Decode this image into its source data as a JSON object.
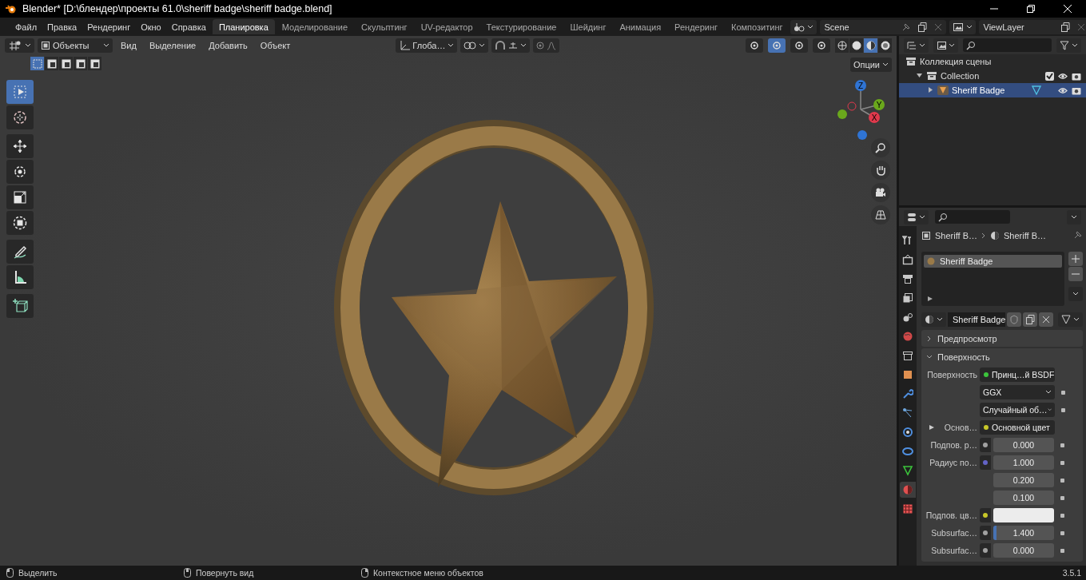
{
  "window": {
    "title": "Blender* [D:\\блендер\\проекты 61.0\\sheriff badge\\sheriff badge.blend]"
  },
  "menu": [
    "Файл",
    "Правка",
    "Рендеринг",
    "Окно",
    "Справка"
  ],
  "workspaces": [
    {
      "label": "Планировка",
      "selected": true
    },
    {
      "label": "Моделирование",
      "selected": false
    },
    {
      "label": "Скульптинг",
      "selected": false
    },
    {
      "label": "UV-редактор",
      "selected": false
    },
    {
      "label": "Текстурирование",
      "selected": false
    },
    {
      "label": "Шейдинг",
      "selected": false
    },
    {
      "label": "Анимация",
      "selected": false
    },
    {
      "label": "Рендеринг",
      "selected": false
    },
    {
      "label": "Композитинг",
      "selected": false
    }
  ],
  "scene": "Scene",
  "view_layer": "ViewLayer",
  "viewport": {
    "mode": "Объекты",
    "menus": [
      "Вид",
      "Выделение",
      "Добавить",
      "Объект"
    ],
    "orientation": "Глоба…",
    "options": "Опции",
    "snap": {
      "on": false
    },
    "select_modes": [
      {
        "selected": true
      },
      {
        "selected": false
      },
      {
        "selected": false
      },
      {
        "selected": false
      },
      {
        "selected": false
      }
    ],
    "toggles": [
      {
        "on": false
      },
      {
        "on": true
      },
      {
        "on": false
      },
      {
        "on": false
      }
    ],
    "shading": [
      {
        "selected": false
      },
      {
        "selected": false
      },
      {
        "selected": true
      },
      {
        "selected": false
      }
    ],
    "tool_groups": [
      [
        {
          "selected": true
        },
        {
          "selected": false
        }
      ],
      [
        {
          "selected": false
        },
        {
          "selected": false
        },
        {
          "selected": false
        },
        {
          "selected": false
        }
      ],
      [
        {
          "selected": false
        },
        {
          "selected": false
        }
      ],
      [
        {
          "selected": false
        }
      ]
    ],
    "gizmo_axes": [
      "Z",
      "Y",
      "X"
    ]
  },
  "outliner": {
    "items": [
      {
        "label": "Коллекция сцены",
        "children": [
          {
            "label": "Collection",
            "expanded": true,
            "checked": true,
            "children": [
              {
                "label": "Sheriff Badge",
                "expanded": false,
                "selected": true
              }
            ]
          }
        ]
      }
    ]
  },
  "properties": {
    "tabs": [
      {
        "selected": false
      },
      {
        "selected": false
      },
      {
        "selected": false
      },
      {
        "selected": false
      },
      {
        "selected": false
      },
      {
        "selected": false
      },
      {
        "selected": false
      },
      {
        "selected": false
      },
      {
        "selected": false
      },
      {
        "selected": false
      },
      {
        "selected": false
      },
      {
        "selected": false
      },
      {
        "selected": false
      },
      {
        "selected": true
      },
      {
        "selected": false
      }
    ],
    "breadcrumb": [
      "Sheriff B…",
      "Sheriff B…"
    ],
    "material_slots": [
      {
        "label": "Sheriff Badge",
        "selected": true
      }
    ],
    "material_name": "Sheriff Badge",
    "panels": [
      {
        "label": "Предпросмотр",
        "expanded": false
      },
      {
        "label": "Поверхность",
        "expanded": true
      }
    ],
    "rows": [
      {
        "kind": "link",
        "color": "#3cc43c",
        "label": "Поверхность",
        "value": "Принц…й BSDF"
      },
      {
        "kind": "dropdown",
        "value": "GGX"
      },
      {
        "kind": "dropdown",
        "value": "Случайный об…"
      },
      {
        "kind": "link",
        "color": "#c7c729",
        "label": "Основ…",
        "value": "Основной цвет",
        "expanded": false
      },
      {
        "kind": "number",
        "color": "#a1a1a1",
        "label": "Подпов. р…",
        "values": [
          "0.000"
        ]
      },
      {
        "kind": "number",
        "color": "#6363c7",
        "label": "Радиус по…",
        "values": [
          "1.000",
          "0.200",
          "0.100"
        ]
      },
      {
        "kind": "swatch",
        "color": "#c7c729",
        "label": "Подпов. цв…",
        "swatch": {
          "color": "#ececec"
        }
      },
      {
        "kind": "slider",
        "color": "#a1a1a1",
        "label": "Subsurfac…",
        "value": "1.400",
        "level": 0.05
      },
      {
        "kind": "number",
        "color": "#a1a1a1",
        "label": "Subsurfac…",
        "values": [
          "0.000"
        ]
      }
    ]
  },
  "status_bar": {
    "hints": [
      "Выделить",
      "Повернуть вид",
      "Контекстное меню объектов"
    ],
    "version": "3.5.1"
  }
}
